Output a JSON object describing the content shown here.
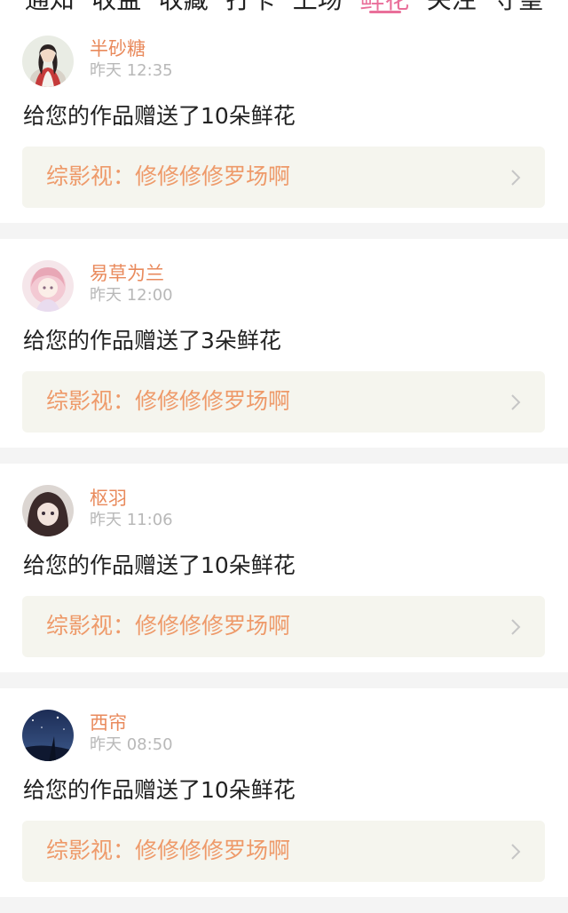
{
  "tabs": [
    {
      "label": "通知",
      "active": false
    },
    {
      "label": "收益",
      "active": false
    },
    {
      "label": "收藏",
      "active": false
    },
    {
      "label": "打卡",
      "active": false
    },
    {
      "label": "上场",
      "active": false
    },
    {
      "label": "鲜花",
      "active": true
    },
    {
      "label": "关注",
      "active": false
    },
    {
      "label": "守望",
      "active": false
    }
  ],
  "accent_color": "#e96f9a",
  "username_color": "#e98a5c",
  "work_title_color": "#ee9a6a",
  "notifications": [
    {
      "username": "半砂糖",
      "time": "昨天 12:35",
      "message": "给您的作品赠送了10朵鲜花",
      "work_title": "综影视：修修修修罗场啊",
      "avatar_icon": "avatar-hanfu-girl-icon"
    },
    {
      "username": "易草为兰",
      "time": "昨天 12:00",
      "message": "给您的作品赠送了3朵鲜花",
      "work_title": "综影视：修修修修罗场啊",
      "avatar_icon": "avatar-pink-anime-girl-icon"
    },
    {
      "username": "枢羽",
      "time": "昨天 11:06",
      "message": "给您的作品赠送了10朵鲜花",
      "work_title": "综影视：修修修修罗场啊",
      "avatar_icon": "avatar-dark-hair-girl-icon"
    },
    {
      "username": "西帘",
      "time": "昨天 08:50",
      "message": "给您的作品赠送了10朵鲜花",
      "work_title": "综影视：修修修修罗场啊",
      "avatar_icon": "avatar-night-sky-icon"
    }
  ]
}
